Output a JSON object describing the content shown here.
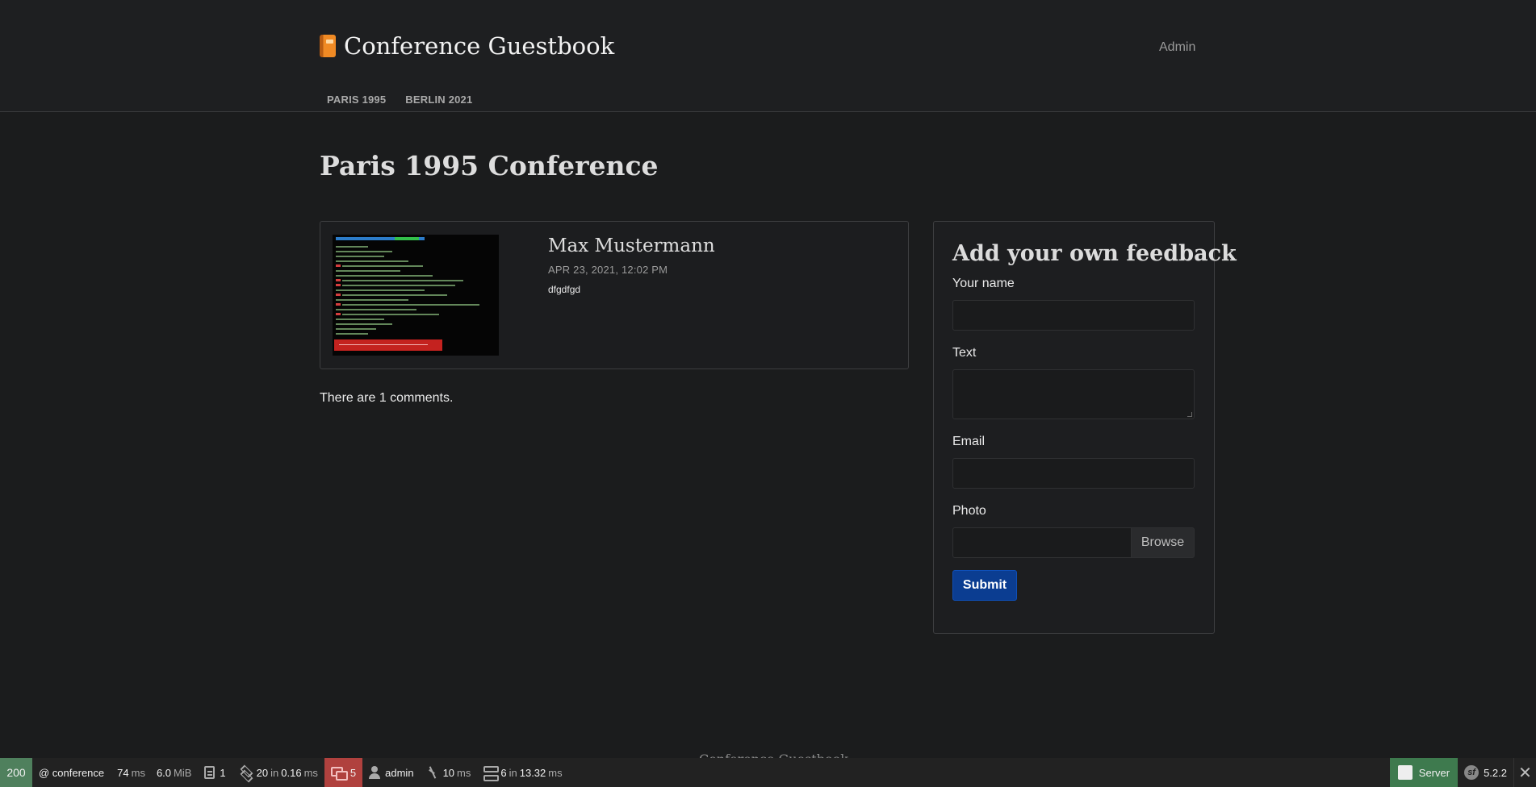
{
  "header": {
    "brand_title": "Conference Guestbook",
    "admin_link": "Admin",
    "nav": [
      "PARIS 1995",
      "BERLIN 2021"
    ]
  },
  "main": {
    "page_title": "Paris 1995 Conference",
    "comment": {
      "author": "Max Mustermann",
      "date": "APR 23, 2021, 12:02 PM",
      "text": "dfgdfgd"
    },
    "comment_count_text": "There are 1 comments."
  },
  "form": {
    "title": "Add your own feedback",
    "name_label": "Your name",
    "text_label": "Text",
    "email_label": "Email",
    "photo_label": "Photo",
    "browse_label": "Browse",
    "submit_label": "Submit"
  },
  "footer": {
    "text": "Conference Guestbook"
  },
  "toolbar": {
    "status": "200",
    "route": "@ conference",
    "time": "74",
    "time_unit": "ms",
    "memory": "6.0",
    "memory_unit": "MiB",
    "logs": "1",
    "twig_count": "20",
    "twig_in": "in",
    "twig_time": "0.16",
    "twig_unit": "ms",
    "errors": "5",
    "user": "admin",
    "perf_time": "10",
    "perf_unit": "ms",
    "db_count": "6",
    "db_in": "in",
    "db_time": "13.32",
    "db_unit": "ms",
    "server": "Server",
    "version": "5.2.2"
  },
  "colors": {
    "status_green": "#4f805d",
    "error_red": "#b0413e",
    "submit_blue": "#0b3d91"
  }
}
